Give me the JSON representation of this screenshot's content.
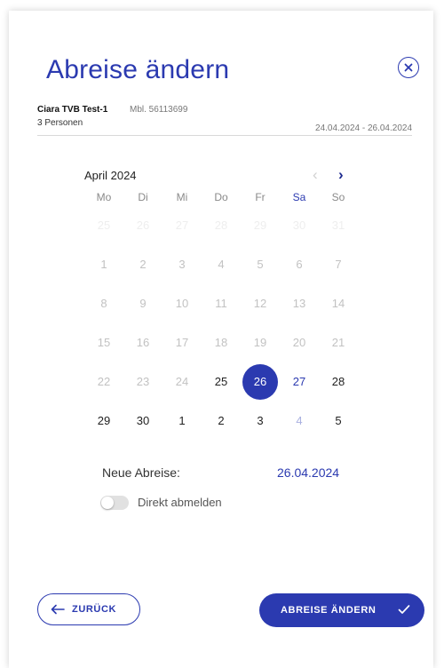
{
  "dialog": {
    "title": "Abreise ändern"
  },
  "guest": {
    "name": "Ciara TVB Test-1",
    "phone": "Mbl. 56113699",
    "persons": "3 Personen",
    "dates": "24.04.2024 - 26.04.2024"
  },
  "calendar": {
    "month_label": "April 2024",
    "prev_glyph": "‹",
    "next_glyph": "›",
    "weekdays": [
      "Mo",
      "Di",
      "Mi",
      "Do",
      "Fr",
      "Sa",
      "So"
    ],
    "weeks": [
      [
        "25",
        "26",
        "27",
        "28",
        "29",
        "30",
        "31"
      ],
      [
        "1",
        "2",
        "3",
        "4",
        "5",
        "6",
        "7"
      ],
      [
        "8",
        "9",
        "10",
        "11",
        "12",
        "13",
        "14"
      ],
      [
        "15",
        "16",
        "17",
        "18",
        "19",
        "20",
        "21"
      ],
      [
        "22",
        "23",
        "24",
        "25",
        "26",
        "27",
        "28"
      ],
      [
        "29",
        "30",
        "1",
        "2",
        "3",
        "4",
        "5"
      ]
    ],
    "selected_day": "26"
  },
  "new_departure": {
    "label": "Neue Abreise:",
    "value": "26.04.2024"
  },
  "toggle": {
    "label": "Direkt abmelden",
    "checked": false
  },
  "buttons": {
    "back": "ZURÜCK",
    "submit": "ABREISE ÄNDERN"
  },
  "colors": {
    "accent": "#2b3ab0",
    "disabled": "#c2c2c2",
    "outside": "#eeeeee"
  }
}
